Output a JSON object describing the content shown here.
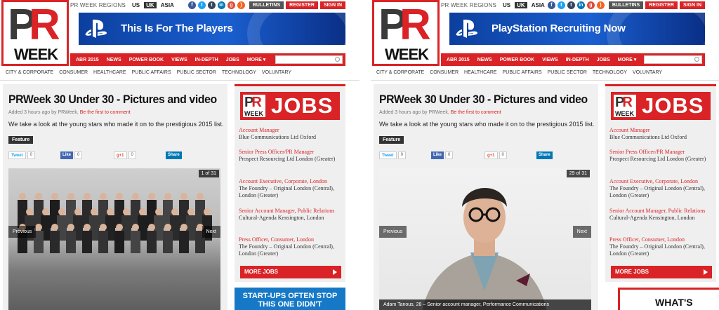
{
  "panels": [
    {
      "id": "left",
      "logo": {
        "pr": "PR",
        "week": "WEEK"
      },
      "topbar": {
        "regions_label": "PR WEEK REGIONS",
        "regions": [
          "US",
          "UK",
          "ASIA"
        ],
        "selected": "UK",
        "buttons": [
          "BULLETINS",
          "REGISTER",
          "SIGN IN"
        ]
      },
      "banner": {
        "text": "This Is For The Players"
      },
      "nav": [
        "ABR 2015",
        "NEWS",
        "POWER BOOK",
        "VIEWS",
        "IN-DEPTH",
        "JOBS",
        "MORE ▾"
      ],
      "search_placeholder": "Search",
      "subnav": [
        "CITY & CORPORATE",
        "CONSUMER",
        "HEALTHCARE",
        "PUBLIC AFFAIRS",
        "PUBLIC SECTOR",
        "TECHNOLOGY",
        "VOLUNTARY"
      ],
      "article": {
        "title": "PRWeek 30 Under 30 - Pictures and video",
        "meta_prefix": "Added 3 hours ago by",
        "meta_author": "PRWeek",
        "meta_sep": ",",
        "meta_comment": "Be the first to comment",
        "summary": "We take a look at the young stars who made it on to the prestigious 2015 list.",
        "tag": "Feature"
      },
      "share": {
        "tweet": "Tweet",
        "tweet_count": "0",
        "like": "Like",
        "like_count": "0",
        "gplus": "g+1",
        "gplus_count": "0",
        "linkedin": "Share"
      },
      "gallery": {
        "counter": "1 of 31",
        "prev": "Previous",
        "next": "Next",
        "caption": ""
      },
      "jobs": {
        "header": "JOBS",
        "more": "MORE JOBS",
        "items": [
          {
            "title": "Account Manager",
            "company": "Blue Communications Ltd Oxford"
          },
          {
            "title": "Senior Press Officer/PR Manager",
            "company": "Prospect Resourcing Ltd London (Greater)"
          },
          {
            "title": "Account Executive, Corporate, London",
            "company": "The Foundry – Original London (Central), London (Greater)"
          },
          {
            "title": "Senior Account Manager, Public Relations",
            "company": "Cultural-Agenda Kensington, London"
          },
          {
            "title": "Press Officer, Consumer, London",
            "company": "The Foundry – Original London (Central), London (Greater)"
          }
        ]
      },
      "ad2": "START-UPS OFTEN STOP THIS ONE DIDN'T"
    },
    {
      "id": "right",
      "logo": {
        "pr": "PR",
        "week": "WEEK"
      },
      "topbar": {
        "regions_label": "PR WEEK REGIONS",
        "regions": [
          "US",
          "UK",
          "ASIA"
        ],
        "selected": "UK",
        "buttons": [
          "BULLETINS",
          "REGISTER",
          "SIGN IN"
        ]
      },
      "banner": {
        "text": "PlayStation Recruiting Now"
      },
      "nav": [
        "ABR 2015",
        "NEWS",
        "POWER BOOK",
        "VIEWS",
        "IN-DEPTH",
        "JOBS",
        "MORE ▾"
      ],
      "search_placeholder": "Search",
      "subnav": [
        "CITY & CORPORATE",
        "CONSUMER",
        "HEALTHCARE",
        "PUBLIC AFFAIRS",
        "PUBLIC SECTOR",
        "TECHNOLOGY",
        "VOLUNTARY"
      ],
      "article": {
        "title": "PRWeek 30 Under 30 - Pictures and video",
        "meta_prefix": "Added 3 hours ago by",
        "meta_author": "PRWeek",
        "meta_sep": ",",
        "meta_comment": "Be the first to comment",
        "summary": "We take a look at the young stars who made it on to the prestigious 2015 list.",
        "tag": "Feature"
      },
      "share": {
        "tweet": "Tweet",
        "tweet_count": "0",
        "like": "Like",
        "like_count": "0",
        "gplus": "g+1",
        "gplus_count": "0",
        "linkedin": "Share"
      },
      "gallery": {
        "counter": "29 of 31",
        "prev": "Previous",
        "next": "Next",
        "caption": "Adam Tanous, 28 – Senior account manager, Performance Communications"
      },
      "jobs": {
        "header": "JOBS",
        "more": "MORE JOBS",
        "items": [
          {
            "title": "Account Manager",
            "company": "Blue Communications Ltd Oxford"
          },
          {
            "title": "Senior Press Officer/PR Manager",
            "company": "Prospect Resourcing Ltd London (Greater)"
          },
          {
            "title": "Account Executive, Corporate, London",
            "company": "The Foundry – Original London (Central), London (Greater)"
          },
          {
            "title": "Senior Account Manager, Public Relations",
            "company": "Cultural-Agenda Kensington, London"
          },
          {
            "title": "Press Officer, Consumer, London",
            "company": "The Foundry – Original London (Central), London (Greater)"
          }
        ]
      },
      "ad2": "WHAT'S YOUR"
    }
  ],
  "colors": {
    "brand_red": "#d92326",
    "social": [
      "#3b5998",
      "#1da1f2",
      "#35465c",
      "#0077b5",
      "#dd4b39",
      "#f26522"
    ]
  },
  "icons": {
    "social": [
      "facebook-icon",
      "twitter-icon",
      "tumblr-icon",
      "linkedin-icon",
      "googleplus-icon",
      "rss-icon"
    ],
    "banner": "playstation-icon"
  }
}
